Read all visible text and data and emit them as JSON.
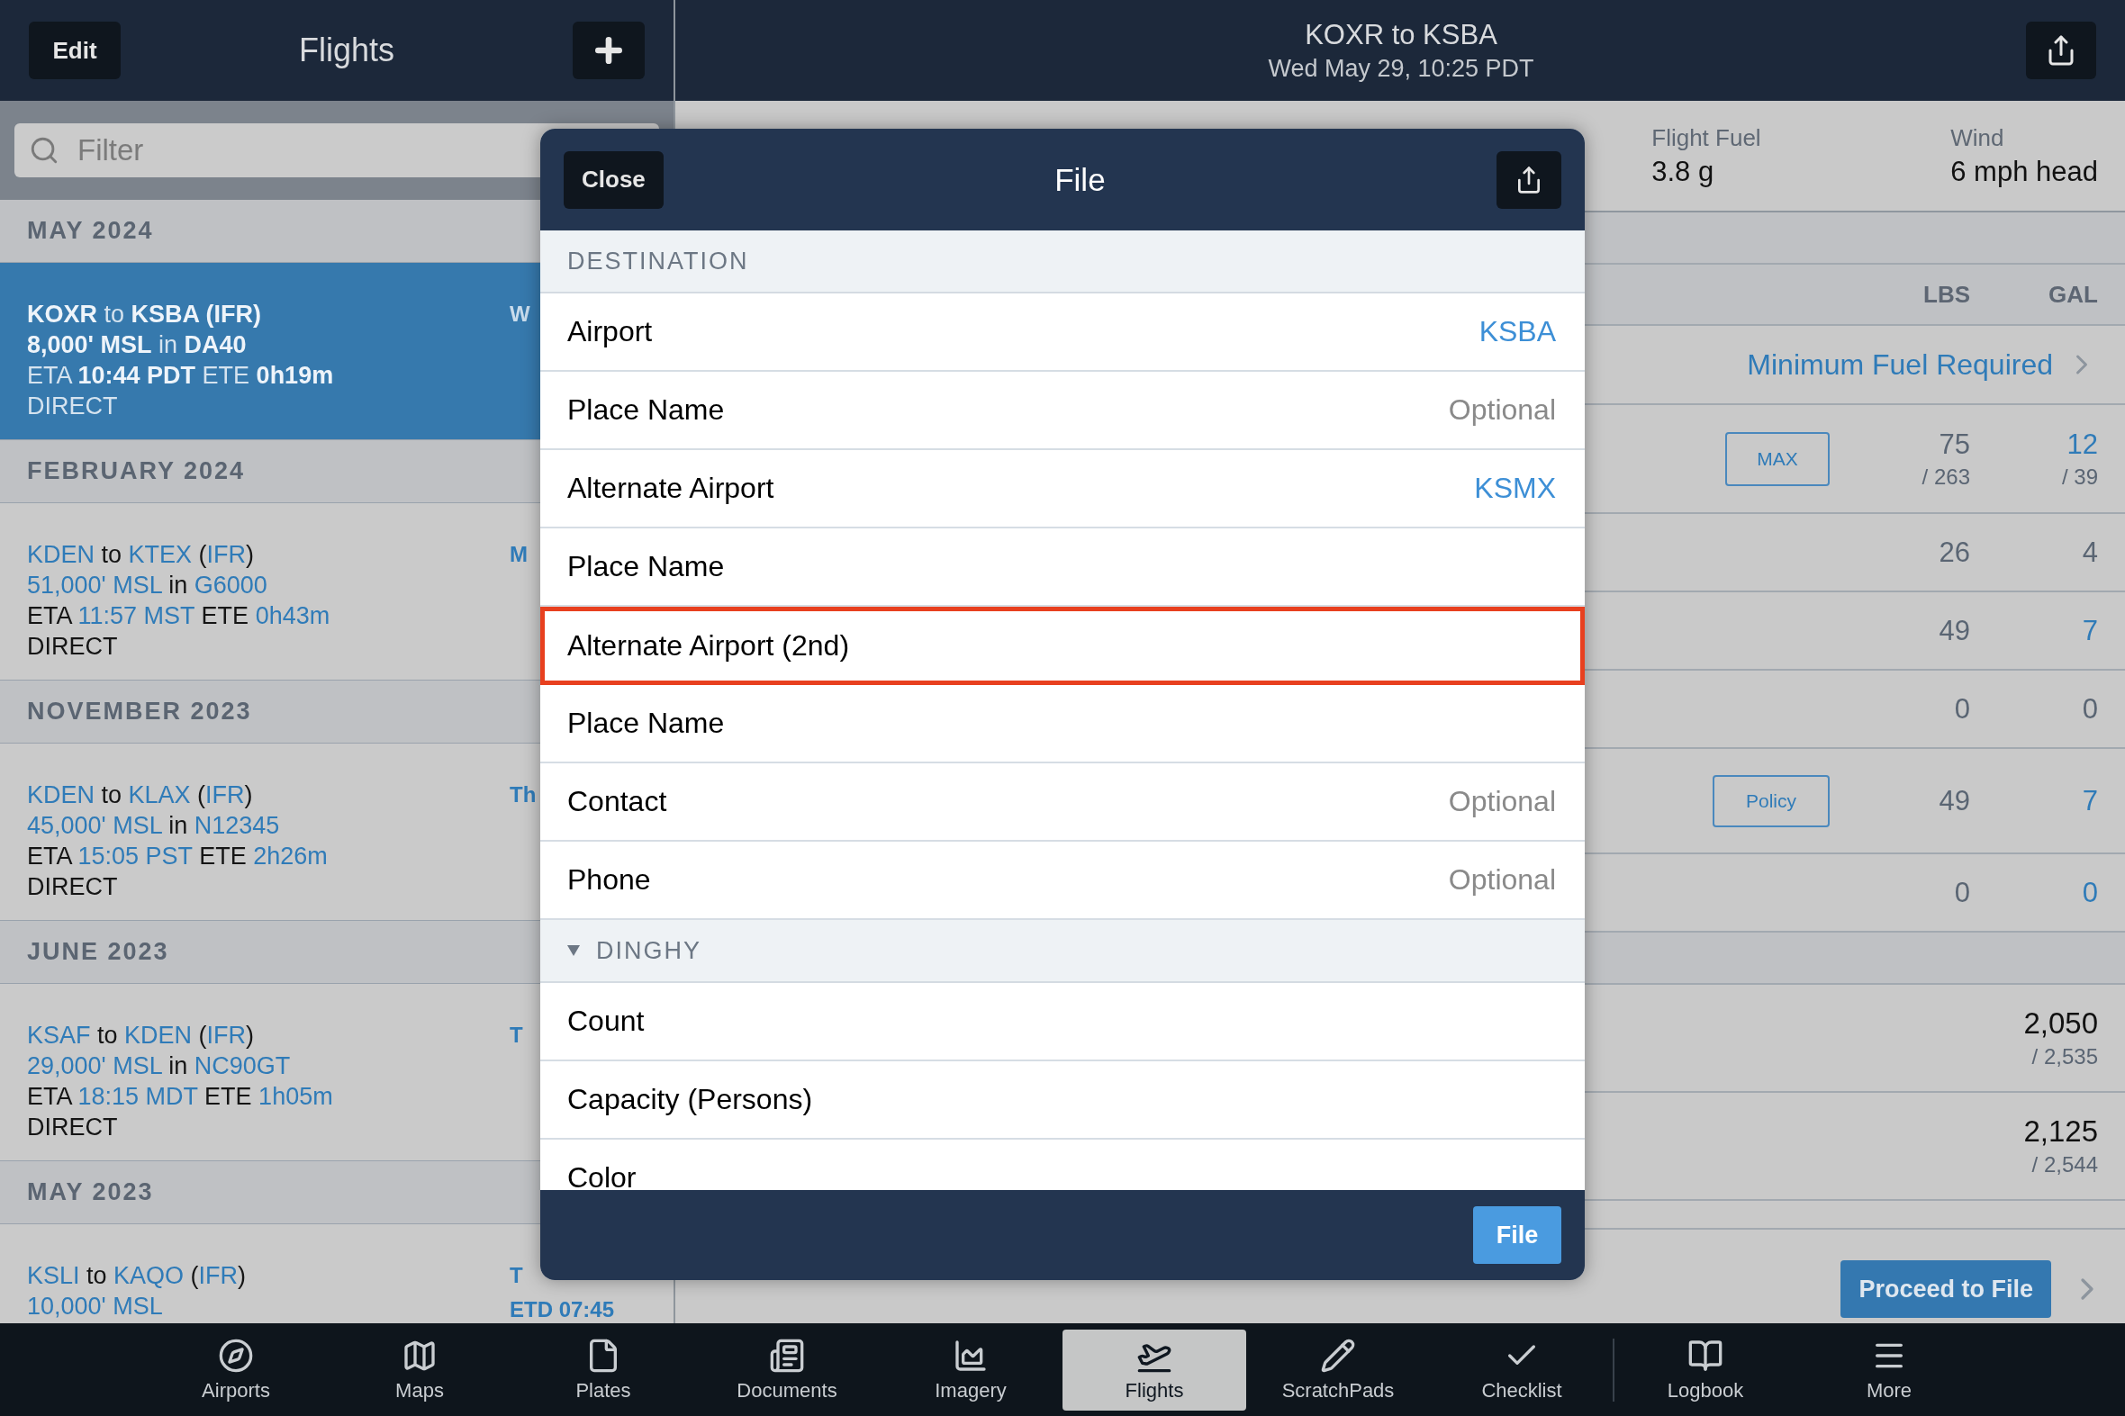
{
  "left_header": {
    "edit": "Edit",
    "title": "Flights"
  },
  "filter": {
    "placeholder": "Filter"
  },
  "flight_groups": [
    {
      "month": "MAY 2024",
      "flights": [
        {
          "selected": true,
          "when": [
            "W"
          ],
          "lines": [
            [
              {
                "text": "KOXR",
                "hl": true
              },
              {
                "text": " to ",
                "hl": false
              },
              {
                "text": "KSBA (IFR)",
                "hl": true
              }
            ],
            [
              {
                "text": "8,000' MSL",
                "hl": true
              },
              {
                "text": " in ",
                "hl": false
              },
              {
                "text": "DA40",
                "hl": true
              }
            ],
            [
              {
                "text": "ETA ",
                "hl": false
              },
              {
                "text": "10:44 PDT",
                "hl": true
              },
              {
                "text": " ETE ",
                "hl": false
              },
              {
                "text": "0h19m",
                "hl": true
              }
            ],
            [
              {
                "text": "DIRECT",
                "hl": false
              }
            ]
          ]
        }
      ]
    },
    {
      "month": "FEBRUARY 2024",
      "flights": [
        {
          "selected": false,
          "when": [
            "M"
          ],
          "lines": [
            [
              {
                "text": "KDEN",
                "hl": true
              },
              {
                "text": " to ",
                "hl": false
              },
              {
                "text": "KTEX",
                "hl": true
              },
              {
                "text": " (",
                "hl": false
              },
              {
                "text": "IFR",
                "hl": true
              },
              {
                "text": ")",
                "hl": false
              }
            ],
            [
              {
                "text": "51,000' MSL",
                "hl": true
              },
              {
                "text": " in ",
                "hl": false
              },
              {
                "text": "G6000",
                "hl": true
              }
            ],
            [
              {
                "text": "ETA ",
                "hl": false
              },
              {
                "text": "11:57 MST",
                "hl": true
              },
              {
                "text": " ETE ",
                "hl": false
              },
              {
                "text": "0h43m",
                "hl": true
              }
            ],
            [
              {
                "text": "DIRECT",
                "hl": false
              }
            ]
          ]
        }
      ]
    },
    {
      "month": "NOVEMBER 2023",
      "flights": [
        {
          "selected": false,
          "when": [
            "Th"
          ],
          "lines": [
            [
              {
                "text": "KDEN",
                "hl": true
              },
              {
                "text": " to ",
                "hl": false
              },
              {
                "text": "KLAX",
                "hl": true
              },
              {
                "text": " (",
                "hl": false
              },
              {
                "text": "IFR",
                "hl": true
              },
              {
                "text": ")",
                "hl": false
              }
            ],
            [
              {
                "text": "45,000' MSL",
                "hl": true
              },
              {
                "text": " in ",
                "hl": false
              },
              {
                "text": "N12345",
                "hl": true
              }
            ],
            [
              {
                "text": "ETA ",
                "hl": false
              },
              {
                "text": "15:05 PST",
                "hl": true
              },
              {
                "text": " ETE ",
                "hl": false
              },
              {
                "text": "2h26m",
                "hl": true
              }
            ],
            [
              {
                "text": "DIRECT",
                "hl": false
              }
            ]
          ]
        }
      ]
    },
    {
      "month": "JUNE 2023",
      "flights": [
        {
          "selected": false,
          "when": [
            "T"
          ],
          "lines": [
            [
              {
                "text": "KSAF",
                "hl": true
              },
              {
                "text": " to ",
                "hl": false
              },
              {
                "text": "KDEN",
                "hl": true
              },
              {
                "text": " (",
                "hl": false
              },
              {
                "text": "IFR",
                "hl": true
              },
              {
                "text": ")",
                "hl": false
              }
            ],
            [
              {
                "text": "29,000' MSL",
                "hl": true
              },
              {
                "text": " in ",
                "hl": false
              },
              {
                "text": "NC90GT",
                "hl": true
              }
            ],
            [
              {
                "text": "ETA ",
                "hl": false
              },
              {
                "text": "18:15 MDT",
                "hl": true
              },
              {
                "text": " ETE ",
                "hl": false
              },
              {
                "text": "1h05m",
                "hl": true
              }
            ],
            [
              {
                "text": "DIRECT",
                "hl": false
              }
            ]
          ]
        }
      ]
    },
    {
      "month": "MAY 2023",
      "flights": [
        {
          "selected": false,
          "when": [
            "T",
            "ETD 07:45"
          ],
          "lines": [
            [
              {
                "text": "KSLI",
                "hl": true
              },
              {
                "text": " to ",
                "hl": false
              },
              {
                "text": "KAQO",
                "hl": true
              },
              {
                "text": " (",
                "hl": false
              },
              {
                "text": "IFR",
                "hl": true
              },
              {
                "text": ")",
                "hl": false
              }
            ],
            [
              {
                "text": "10,000' MSL",
                "hl": true
              }
            ]
          ]
        }
      ]
    }
  ],
  "detail_header": {
    "title": "KOXR to KSBA",
    "subtitle": "Wed May 29, 10:25 PDT"
  },
  "detail_rows": [
    {
      "kind": "stats",
      "items": [
        {
          "label": "Flight Fuel",
          "value": "3.8 g"
        },
        {
          "label": "Wind",
          "value": "6 mph head"
        }
      ]
    },
    {
      "kind": "band"
    },
    {
      "kind": "header",
      "columns": [
        "LBS",
        "GAL"
      ]
    },
    {
      "kind": "link",
      "label": "Minimum Fuel Required"
    },
    {
      "kind": "numbers",
      "button": "MAX",
      "lbs": {
        "value": "75",
        "sub": "/ 263",
        "hl": false
      },
      "gal": {
        "value": "12",
        "sub": "/ 39",
        "hl": true
      }
    },
    {
      "kind": "numbers",
      "lbs": {
        "value": "26",
        "hl": false
      },
      "gal": {
        "value": "4",
        "hl": false
      }
    },
    {
      "kind": "numbers",
      "lbs": {
        "value": "49",
        "hl": false
      },
      "gal": {
        "value": "7",
        "hl": true
      }
    },
    {
      "kind": "numbers",
      "lbs": {
        "value": "0",
        "hl": false
      },
      "gal": {
        "value": "0",
        "hl": false
      }
    },
    {
      "kind": "numbers",
      "button": "Policy",
      "lbs": {
        "value": "49",
        "hl": false
      },
      "gal": {
        "value": "7",
        "hl": true
      }
    },
    {
      "kind": "numbers",
      "lbs": {
        "value": "0",
        "hl": false
      },
      "gal": {
        "value": "0",
        "hl": true
      }
    },
    {
      "kind": "band"
    },
    {
      "kind": "total",
      "value": "2,050",
      "sub": "/ 2,535"
    },
    {
      "kind": "total",
      "value": "2,125",
      "sub": "/ 2,544"
    },
    {
      "kind": "action",
      "button": "Proceed to File"
    }
  ],
  "modal": {
    "close": "Close",
    "title": "File",
    "submit": "File",
    "rows": [
      {
        "kind": "section",
        "label": "DESTINATION"
      },
      {
        "kind": "field",
        "label": "Airport",
        "value": "KSBA",
        "highlighted": false
      },
      {
        "kind": "field",
        "label": "Place Name",
        "placeholder": "Optional",
        "highlighted": false
      },
      {
        "kind": "field",
        "label": "Alternate Airport",
        "value": "KSMX",
        "highlighted": false
      },
      {
        "kind": "field",
        "label": "Place Name",
        "highlighted": false
      },
      {
        "kind": "field",
        "label": "Alternate Airport (2nd)",
        "highlighted": true
      },
      {
        "kind": "field",
        "label": "Place Name",
        "highlighted": false
      },
      {
        "kind": "field",
        "label": "Contact",
        "placeholder": "Optional",
        "highlighted": false
      },
      {
        "kind": "field",
        "label": "Phone",
        "placeholder": "Optional",
        "highlighted": false
      },
      {
        "kind": "section",
        "label": "DINGHY",
        "expanded": true
      },
      {
        "kind": "field",
        "label": "Count",
        "highlighted": false
      },
      {
        "kind": "field",
        "label": "Capacity (Persons)",
        "highlighted": false
      },
      {
        "kind": "field",
        "label": "Color",
        "highlighted": false
      }
    ]
  },
  "tab_bar": [
    {
      "label": "Airports",
      "selected": false,
      "separated": false
    },
    {
      "label": "Maps",
      "selected": false,
      "separated": false
    },
    {
      "label": "Plates",
      "selected": false,
      "separated": false
    },
    {
      "label": "Documents",
      "selected": false,
      "separated": false
    },
    {
      "label": "Imagery",
      "selected": false,
      "separated": false
    },
    {
      "label": "Flights",
      "selected": true,
      "separated": false
    },
    {
      "label": "ScratchPads",
      "selected": false,
      "separated": false
    },
    {
      "label": "Checklist",
      "selected": false,
      "separated": false
    },
    {
      "label": "Logbook",
      "selected": false,
      "separated": true
    },
    {
      "label": "More",
      "selected": false,
      "separated": false
    }
  ]
}
